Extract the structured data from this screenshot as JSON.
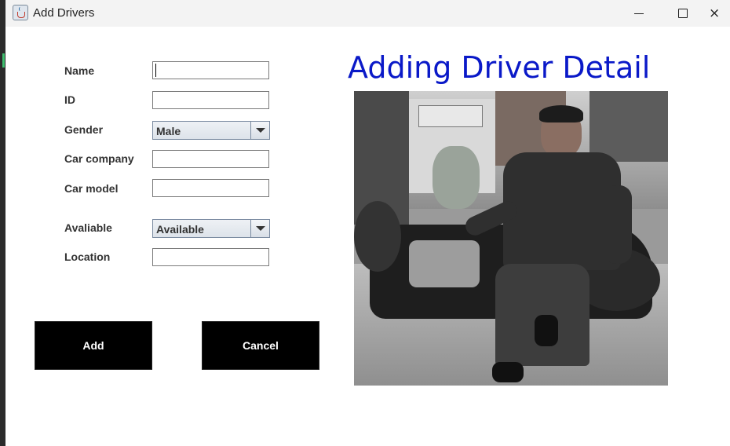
{
  "window": {
    "title": "Add Drivers",
    "icon": "java-cup-icon",
    "controls": {
      "minimize": "minimize-icon",
      "maximize": "maximize-icon",
      "close": "×"
    }
  },
  "form": {
    "name": {
      "label": "Name",
      "value": ""
    },
    "id": {
      "label": "ID",
      "value": ""
    },
    "gender": {
      "label": "Gender",
      "selected": "Male"
    },
    "car_company": {
      "label": "Car company",
      "value": ""
    },
    "car_model": {
      "label": "Car model",
      "value": ""
    },
    "available": {
      "label": "Avaliable",
      "selected": "Available"
    },
    "location": {
      "label": "Location",
      "value": ""
    }
  },
  "buttons": {
    "add": "Add",
    "cancel": "Cancel"
  },
  "heading": "Adding Driver Detail",
  "colors": {
    "heading": "#0a19c8",
    "button_bg": "#000000",
    "button_text": "#ffffff"
  }
}
